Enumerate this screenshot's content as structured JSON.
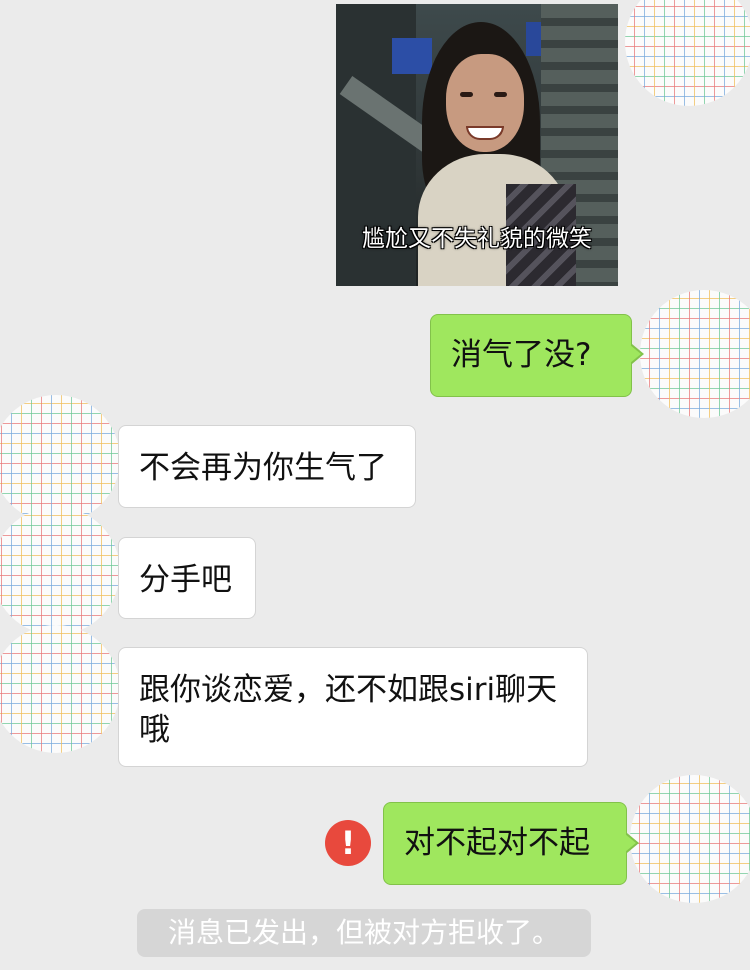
{
  "messages": [
    {
      "id": "sticker",
      "sender": "me",
      "type": "sticker",
      "caption": "尴尬又不失礼貌的微笑"
    },
    {
      "id": "m1",
      "sender": "me",
      "text": "消气了没?"
    },
    {
      "id": "m2",
      "sender": "other",
      "text": "不会再为你生气了"
    },
    {
      "id": "m3",
      "sender": "other",
      "text": "分手吧"
    },
    {
      "id": "m4",
      "sender": "other",
      "lines": [
        "跟你谈恋爱，还不如跟siri聊天",
        "哦"
      ]
    },
    {
      "id": "m5",
      "sender": "me",
      "text": "对不起对不起",
      "status": "failed"
    }
  ],
  "warning_icon": {
    "name": "exclamation-icon",
    "glyph": "!",
    "color": "#e8493d"
  },
  "system_notice": "消息已发出，但被对方拒收了。",
  "colors": {
    "background": "#ebebeb",
    "outgoing_bubble": "#9fe75e",
    "incoming_bubble": "#ffffff",
    "notice_background": "#d6d6d6"
  }
}
